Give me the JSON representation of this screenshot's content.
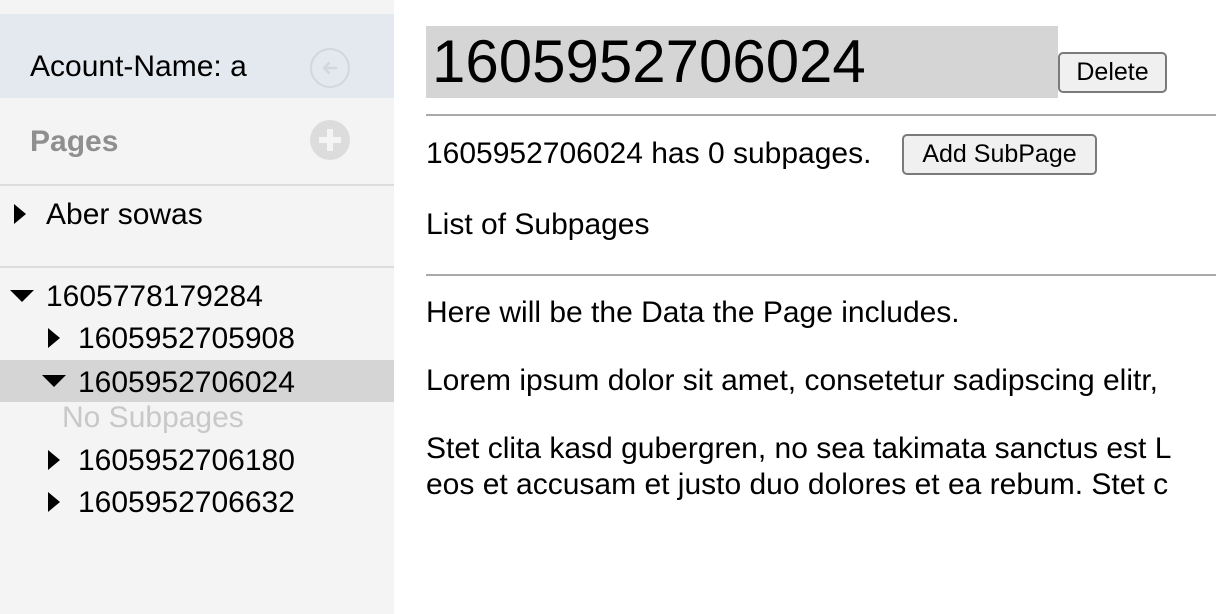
{
  "sidebar": {
    "account_label": "Acount-Name: a",
    "pages_heading": "Pages",
    "tree": {
      "item0": "Aber sowas",
      "item1": "1605778179284",
      "item1_children": [
        "1605952705908",
        "1605952706024",
        "1605952706180",
        "1605952706632"
      ],
      "no_subpages": "No Subpages"
    }
  },
  "main": {
    "title": "1605952706024",
    "delete_label": "Delete",
    "subpage_count_text": "1605952706024 has 0 subpages.",
    "add_subpage_label": "Add SubPage",
    "list_heading": "List of Subpages",
    "data_note": "Here will be the Data the Page includes.",
    "lorem1": "Lorem ipsum dolor sit amet, consetetur sadipscing elitr,",
    "lorem2_line1": "Stet clita kasd gubergren, no sea takimata sanctus est L",
    "lorem2_line2": "eos et accusam et justo duo dolores et ea rebum. Stet c"
  },
  "colors": {
    "sidebar_bg": "#f4f4f4",
    "account_bg": "#e4e9ef",
    "selected_bg": "#d5d5d5",
    "title_bg": "#d5d5d5"
  }
}
